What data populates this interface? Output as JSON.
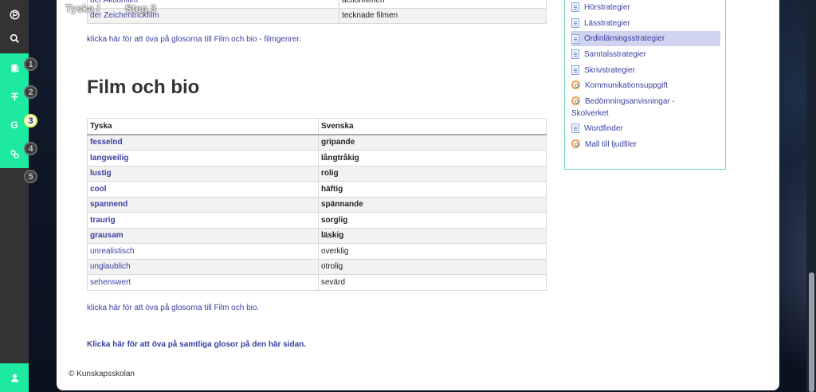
{
  "breadcrumb": {
    "part1": "Tyska /",
    "part2": "Steg 3"
  },
  "rail": {
    "steps": [
      "1",
      "2",
      "3",
      "4",
      "5"
    ]
  },
  "top_table": {
    "rows": [
      {
        "de": "der Aktionfilm",
        "sv": "actionfilmen"
      },
      {
        "de": "der Zeichentrickfilm",
        "sv": "tecknade filmen"
      }
    ]
  },
  "links": {
    "genres": "klicka här för att öva på glosorna till Film och bio - filmgenrer.",
    "film": "klicka här för att öva på glosorna till Film och bio.",
    "all": "Klicka här för att öva på samtliga glosor på den här sidan."
  },
  "section": {
    "heading": "Film och bio"
  },
  "vocab": {
    "headers": {
      "de": "Tyska",
      "sv": "Svenska"
    },
    "rows": [
      {
        "de": "fesselnd",
        "sv": "gripande",
        "bold": true
      },
      {
        "de": "langweilig",
        "sv": "långtråkig",
        "bold": true
      },
      {
        "de": "lustig",
        "sv": "rolig",
        "bold": true
      },
      {
        "de": "cool",
        "sv": "häftig",
        "bold": true
      },
      {
        "de": "spannend",
        "sv": "spännande",
        "bold": true
      },
      {
        "de": "traurig",
        "sv": "sorglig",
        "bold": true
      },
      {
        "de": "grausam",
        "sv": "läskig",
        "bold": true
      },
      {
        "de": "unrealistisch",
        "sv": "overklig",
        "bold": false
      },
      {
        "de": "unglaublich",
        "sv": "otrolig",
        "bold": false
      },
      {
        "de": "sehenswert",
        "sv": "sevärd",
        "bold": false
      }
    ]
  },
  "footer": "© Kunskapsskolan",
  "sidebar": {
    "items": [
      {
        "label": "Hörstrategier",
        "icon": "document-icon"
      },
      {
        "label": "Lässtrategier",
        "icon": "document-icon"
      },
      {
        "label": "Ordinlärningsstrategier",
        "icon": "document-icon",
        "active": true
      },
      {
        "label": "Samtalsstrategier",
        "icon": "document-icon"
      },
      {
        "label": "Skrivstrategier",
        "icon": "document-icon"
      },
      {
        "label": "Kommunikationsuppgift",
        "icon": "link-icon"
      },
      {
        "label": "Bedömningsanvisningar -",
        "label2": "Skolverket",
        "icon": "link-icon"
      },
      {
        "label": "Wordfinder",
        "icon": "document-icon"
      },
      {
        "label": "Mall till ljudfiler",
        "icon": "link-icon"
      }
    ]
  },
  "colors": {
    "accent": "#1de9a0",
    "link": "#3b3fa0",
    "rail": "#333333"
  }
}
